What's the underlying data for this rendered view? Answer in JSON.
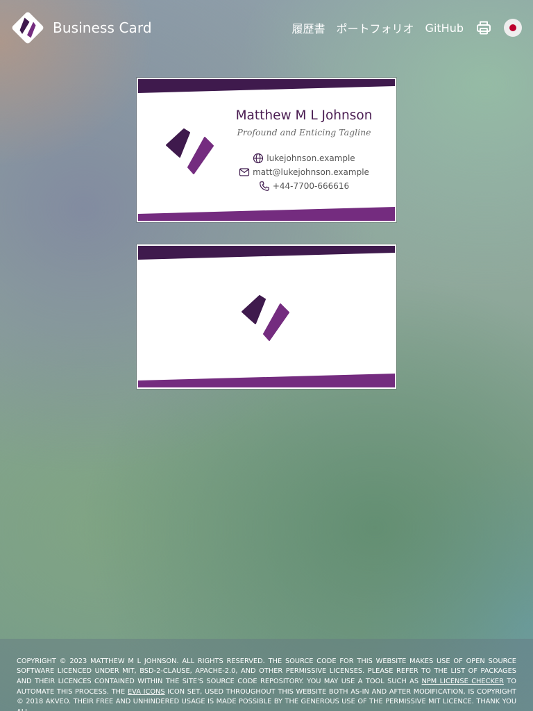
{
  "header": {
    "title": "Business Card",
    "nav": [
      {
        "label": "履歴書"
      },
      {
        "label": "ポートフォリオ"
      },
      {
        "label": "GitHub"
      }
    ],
    "print_icon": "printer-icon",
    "language_icon": "japan-flag-icon"
  },
  "colors": {
    "brand_dark": "#3f1a4d",
    "brand_light": "#742c7f",
    "white": "#ffffff"
  },
  "card_front": {
    "name": "Matthew M L Johnson",
    "tagline": "Profound and Enticing Tagline",
    "contacts": [
      {
        "icon": "globe-icon",
        "text": "lukejohnson.example"
      },
      {
        "icon": "mail-icon",
        "text": "matt@lukejohnson.example"
      },
      {
        "icon": "phone-icon",
        "text": "+44-7700-666616"
      }
    ]
  },
  "card_back": {
    "logo_icon": "brand-logo-icon"
  },
  "footer": {
    "text_1": "Copyright © 2023 Matthew M L Johnson. All rights reserved. The source code for this website makes use of open source software licenced under MIT, BSD-2-Clause, Apache-2.0, and other permissive licenses. Please refer to the list of packages and their licences contained within the site's source code repository. You may use a tool such as ",
    "link_1": "npm license checker",
    "text_2": " to automate this process. The ",
    "link_2": "Eva Icons",
    "text_3": " icon set, used throughout this website both as-in and after modification, is copyright © 2018 Akveo. Their free and unhindered usage is made possible by the generous use of the permissive MIT licence. Thank you all."
  }
}
